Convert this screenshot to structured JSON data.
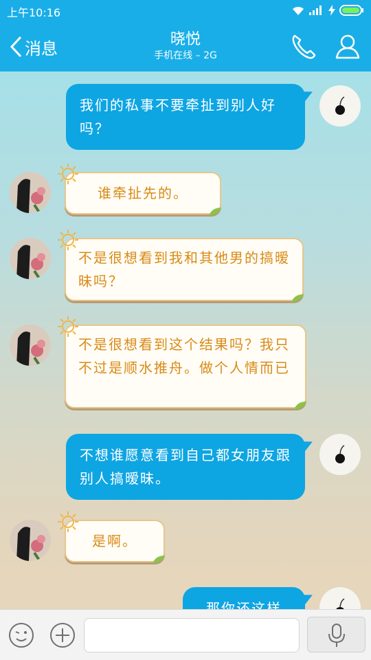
{
  "status_bar": {
    "time": "上午10:16"
  },
  "header": {
    "back_label": "消息",
    "title": "晓悦",
    "subtitle": "手机在线 – 2G"
  },
  "colors": {
    "header": "#1aaee8",
    "outgoing_bubble": "#0ea5e3",
    "incoming_text": "#d98a16"
  },
  "icons": [
    "wifi-icon",
    "signal-icon",
    "charging-icon",
    "battery-icon",
    "back-chevron-icon",
    "phone-icon",
    "profile-icon",
    "emoji-icon",
    "plus-icon",
    "microphone-icon"
  ],
  "messages": [
    {
      "side": "right",
      "text": "我们的私事不要牵扯到别人好吗？"
    },
    {
      "side": "left",
      "text": "谁牵扯先的。"
    },
    {
      "side": "left",
      "text": "不是很想看到我和其他男的搞暧昧吗？"
    },
    {
      "side": "left",
      "text": "不是很想看到这个结果吗？我只不过是顺水推舟。做个人情而已"
    },
    {
      "side": "right",
      "text": "不想谁愿意看到自己都女朋友跟别人搞暧昧。"
    },
    {
      "side": "left",
      "text": "是啊。"
    },
    {
      "side": "right",
      "text": "那你还这样"
    }
  ],
  "input": {
    "value": ""
  }
}
